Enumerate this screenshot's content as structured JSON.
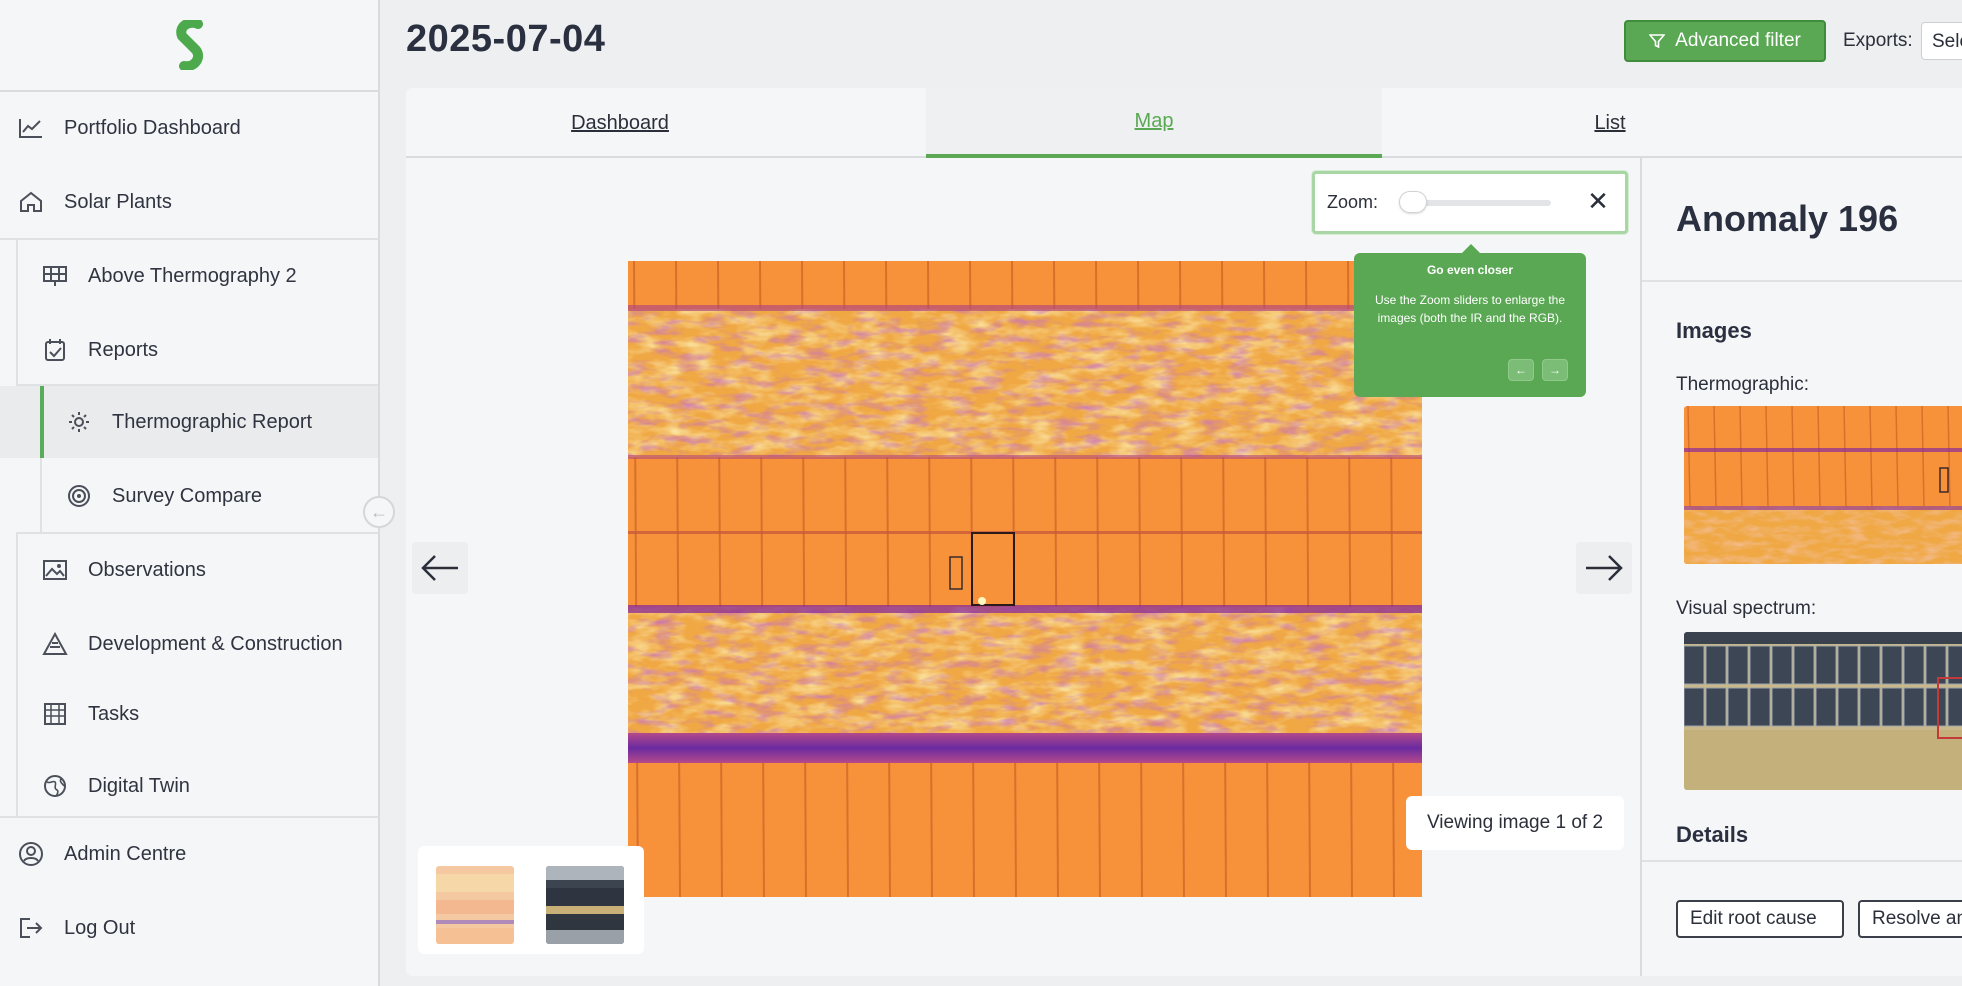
{
  "header": {
    "title": "2025-07-04",
    "advanced_filter_label": "Advanced filter",
    "exports_label": "Exports:",
    "exports_value": "Sele"
  },
  "sidebar": {
    "items": [
      {
        "label": "Portfolio Dashboard",
        "icon": "chart-line-icon"
      },
      {
        "label": "Solar Plants",
        "icon": "home-icon"
      },
      {
        "label": "Above Thermography 2",
        "icon": "solar-panel-icon"
      },
      {
        "label": "Reports",
        "icon": "calendar-check-icon"
      },
      {
        "label": "Thermographic Report",
        "icon": "gear-icon",
        "active": true
      },
      {
        "label": "Survey Compare",
        "icon": "target-icon"
      },
      {
        "label": "Observations",
        "icon": "image-icon"
      },
      {
        "label": "Development & Construction",
        "icon": "construction-icon"
      },
      {
        "label": "Tasks",
        "icon": "table-icon"
      },
      {
        "label": "Digital Twin",
        "icon": "globe-icon"
      },
      {
        "label": "Admin Centre",
        "icon": "user-circle-icon"
      },
      {
        "label": "Log Out",
        "icon": "logout-icon"
      }
    ]
  },
  "tabs": {
    "dashboard": "Dashboard",
    "map": "Map",
    "list": "List",
    "active": "Map"
  },
  "zoom": {
    "label": "Zoom:",
    "value": 0
  },
  "tooltip": {
    "title": "Go even closer",
    "body": "Use the Zoom sliders to enlarge the images (both the IR and the RGB)."
  },
  "viewer": {
    "viewing_text": "Viewing image 1 of 2"
  },
  "detail_panel": {
    "title": "Anomaly 196",
    "images_heading": "Images",
    "thermographic_label": "Thermographic:",
    "visual_label": "Visual spectrum:",
    "details_heading": "Details",
    "edit_button": "Edit root cause",
    "resolve_button": "Resolve an"
  },
  "colors": {
    "accent": "#5aa854",
    "thermal_orange": "#f5893a",
    "thermal_purple": "#7a2f9a"
  }
}
